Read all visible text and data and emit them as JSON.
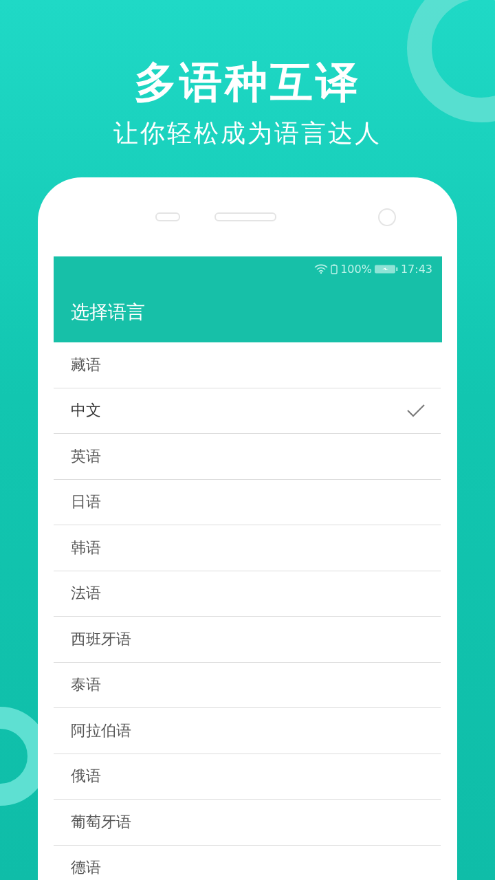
{
  "headline": "多语种互译",
  "subheadline": "让你轻松成为语言达人",
  "status_bar": {
    "battery": "100%",
    "time": "17:43"
  },
  "app_bar": {
    "title": "选择语言"
  },
  "languages": [
    {
      "label": "藏语",
      "selected": false
    },
    {
      "label": "中文",
      "selected": true
    },
    {
      "label": "英语",
      "selected": false
    },
    {
      "label": "日语",
      "selected": false
    },
    {
      "label": "韩语",
      "selected": false
    },
    {
      "label": "法语",
      "selected": false
    },
    {
      "label": "西班牙语",
      "selected": false
    },
    {
      "label": "泰语",
      "selected": false
    },
    {
      "label": "阿拉伯语",
      "selected": false
    },
    {
      "label": "俄语",
      "selected": false
    },
    {
      "label": "葡萄牙语",
      "selected": false
    },
    {
      "label": "德语",
      "selected": false
    }
  ]
}
